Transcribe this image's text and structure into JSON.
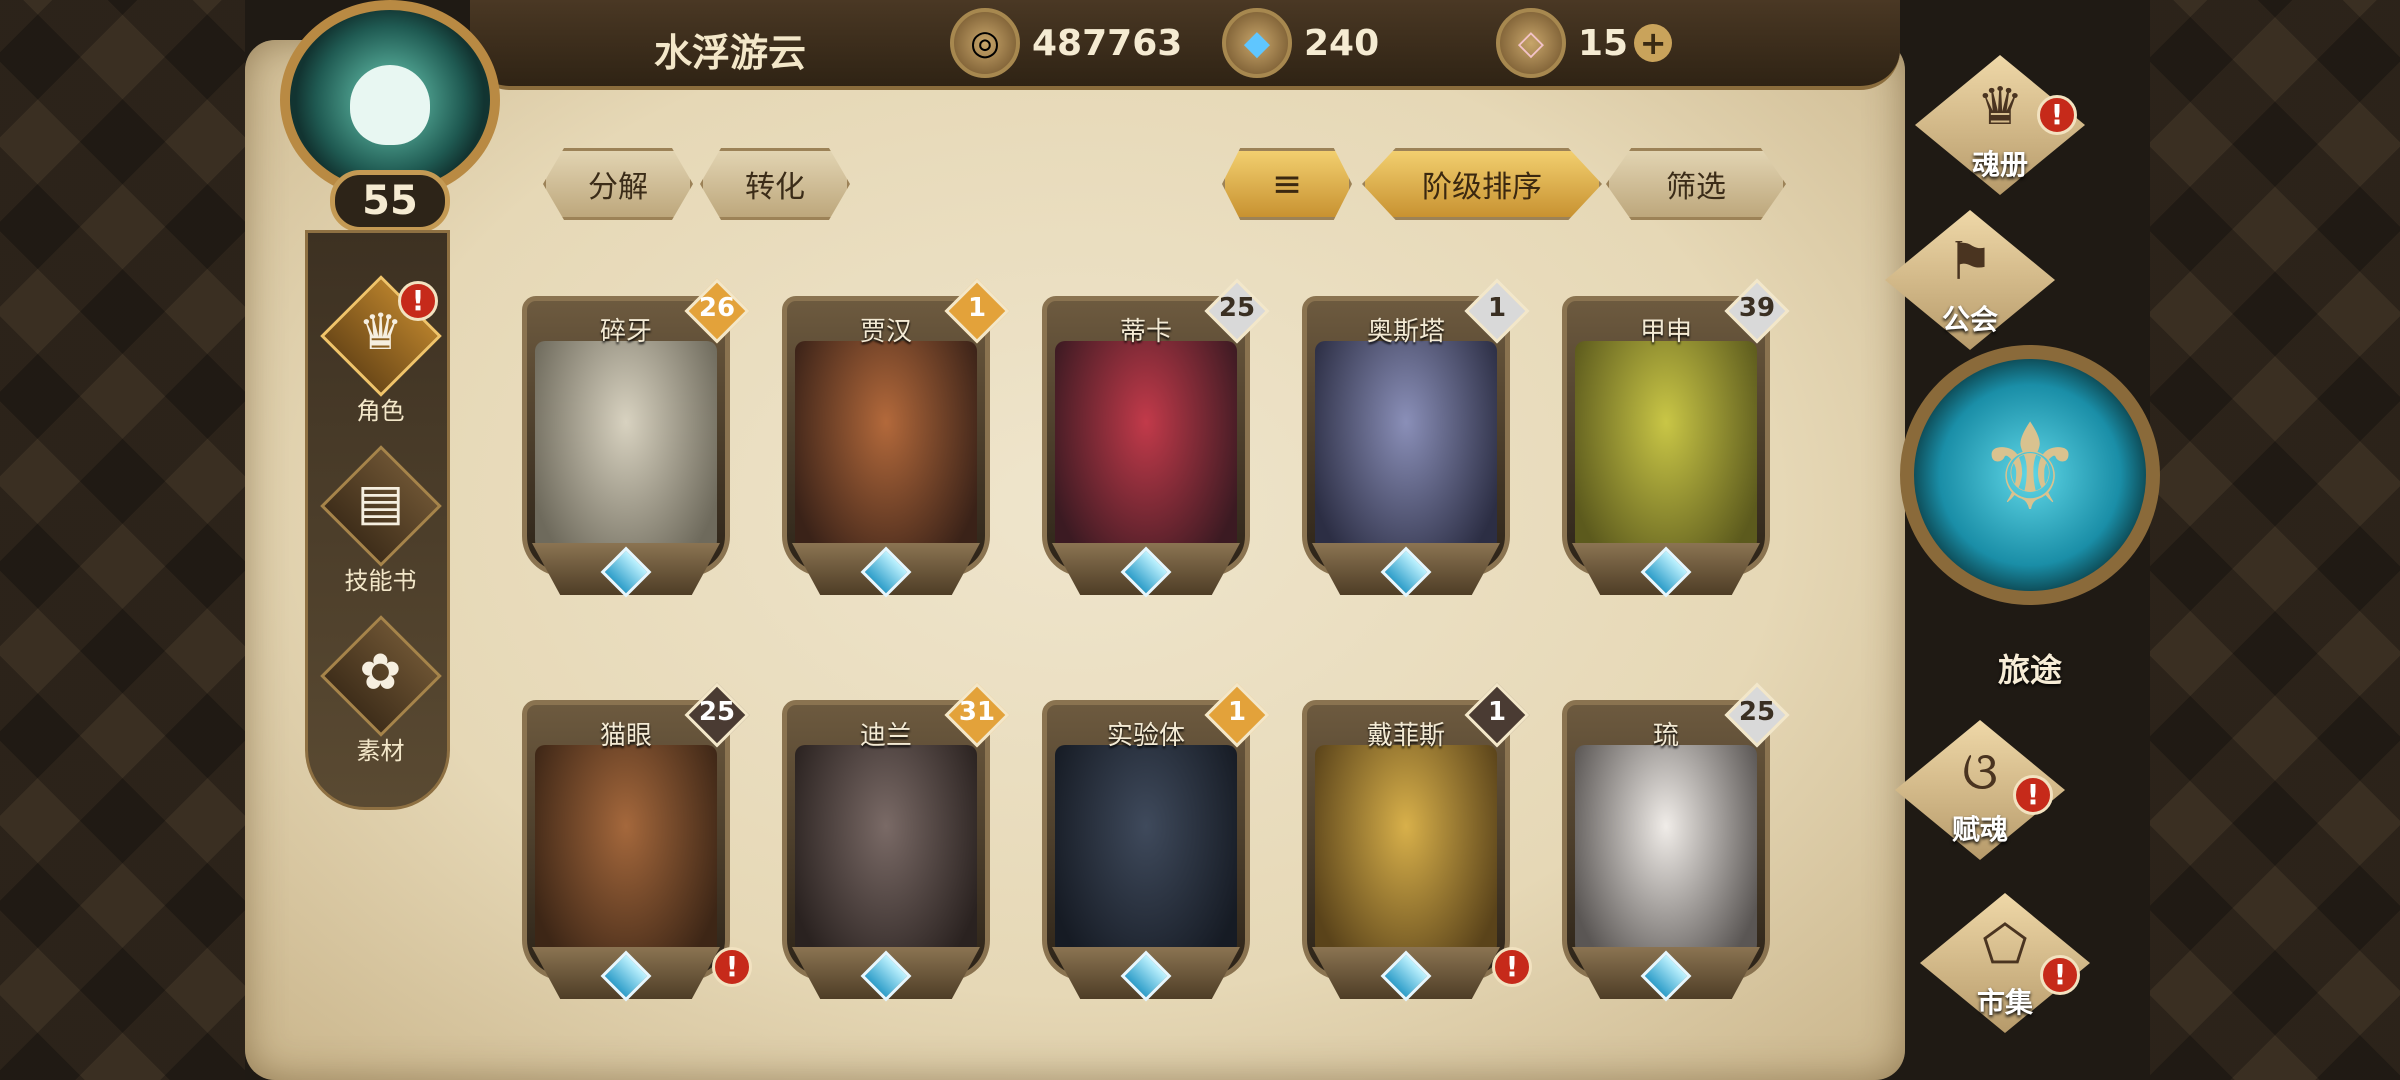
{
  "player": {
    "name": "水浮游云",
    "level": "55"
  },
  "currencies": [
    {
      "icon": "gold-coin-icon",
      "value": "487763"
    },
    {
      "icon": "blue-crystal-icon",
      "value": "240"
    },
    {
      "icon": "pink-gem-icon",
      "value": "15"
    }
  ],
  "topbar": {
    "plus": "+"
  },
  "side_nav": [
    {
      "label": "角色",
      "icon": "character-icon",
      "alert": "!"
    },
    {
      "label": "技能书",
      "icon": "skill-book-icon"
    },
    {
      "label": "素材",
      "icon": "material-icon"
    }
  ],
  "toolbar": {
    "decompose": "分解",
    "convert": "转化",
    "sort_rank": "阶级排序",
    "filter": "筛选"
  },
  "cards": [
    {
      "name": "碎牙",
      "level": "26",
      "tier": "gold",
      "art": [
        "#d8d2c0",
        "#6e6a5c"
      ]
    },
    {
      "name": "贾汉",
      "level": "1",
      "tier": "gold",
      "art": [
        "#b3693b",
        "#3a2218"
      ]
    },
    {
      "name": "蒂卡",
      "level": "25",
      "tier": "silver",
      "art": [
        "#c23a4a",
        "#3b1a22"
      ]
    },
    {
      "name": "奥斯塔",
      "level": "1",
      "tier": "silver",
      "art": [
        "#8a8fb8",
        "#2c2e44"
      ]
    },
    {
      "name": "甲申",
      "level": "39",
      "tier": "silver",
      "art": [
        "#c9c646",
        "#5c5a1d"
      ]
    },
    {
      "name": "猫眼",
      "level": "25",
      "tier": "dark",
      "art": [
        "#a5683c",
        "#3d2616"
      ],
      "alert": "!"
    },
    {
      "name": "迪兰",
      "level": "31",
      "tier": "gold",
      "art": [
        "#7a6a66",
        "#2a2220"
      ]
    },
    {
      "name": "实验体",
      "level": "1",
      "tier": "gold",
      "art": [
        "#3f4a5c",
        "#161b24"
      ]
    },
    {
      "name": "戴菲斯",
      "level": "1",
      "tier": "dark",
      "art": [
        "#d8b04a",
        "#5a431a"
      ],
      "alert": "!"
    },
    {
      "name": "琉",
      "level": "25",
      "tier": "silver",
      "art": [
        "#f0ece8",
        "#5a5654"
      ]
    }
  ],
  "right_nav": [
    {
      "label": "魂册",
      "icon": "soul-book-icon",
      "alert": "!"
    },
    {
      "label": "公会",
      "icon": "guild-icon"
    },
    {
      "label": "旅途",
      "icon": "journey-icon"
    },
    {
      "label": "赋魂",
      "icon": "soul-infuse-icon",
      "alert": "!"
    },
    {
      "label": "市集",
      "icon": "market-icon",
      "alert": "!"
    }
  ],
  "colors": {
    "gold_tier": "#e3a23a",
    "silver_tier": "#d9d9d9",
    "dark_tier": "#4a3b33",
    "alert": "#c62a1a"
  }
}
